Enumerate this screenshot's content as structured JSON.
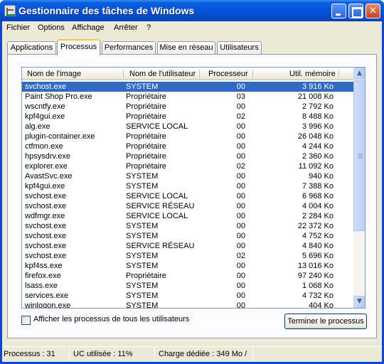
{
  "window": {
    "title": "Gestionnaire des tâches de Windows"
  },
  "menu": [
    "Fichier",
    "Options",
    "Affichage",
    "Arrêter",
    "?"
  ],
  "tabs": [
    "Applications",
    "Processus",
    "Performances",
    "Mise en réseau",
    "Utilisateurs"
  ],
  "active_tab": "Processus",
  "columns": [
    "Nom de l'image",
    "Nom de l'utilisateur",
    "Processeur",
    "Util. mémoire"
  ],
  "processes": [
    {
      "name": "svchost.exe",
      "user": "SYSTEM",
      "cpu": "00",
      "mem": "3 916 Ko",
      "selected": true
    },
    {
      "name": "Paint Shop Pro.exe",
      "user": "Propriétaire",
      "cpu": "03",
      "mem": "21 008 Ko"
    },
    {
      "name": "wscntfy.exe",
      "user": "Propriétaire",
      "cpu": "00",
      "mem": "2 792 Ko"
    },
    {
      "name": "kpf4gui.exe",
      "user": "Propriétaire",
      "cpu": "02",
      "mem": "8 488 Ko"
    },
    {
      "name": "alg.exe",
      "user": "SERVICE LOCAL",
      "cpu": "00",
      "mem": "3 996 Ko"
    },
    {
      "name": "plugin-container.exe",
      "user": "Propriétaire",
      "cpu": "00",
      "mem": "26 048 Ko"
    },
    {
      "name": "ctfmon.exe",
      "user": "Propriétaire",
      "cpu": "00",
      "mem": "4 244 Ko"
    },
    {
      "name": "hpsysdrv.exe",
      "user": "Propriétaire",
      "cpu": "00",
      "mem": "2 360 Ko"
    },
    {
      "name": "explorer.exe",
      "user": "Propriétaire",
      "cpu": "02",
      "mem": "11 092 Ko"
    },
    {
      "name": "AvastSvc.exe",
      "user": "SYSTEM",
      "cpu": "00",
      "mem": "940 Ko"
    },
    {
      "name": "kpf4gui.exe",
      "user": "SYSTEM",
      "cpu": "00",
      "mem": "7 388 Ko"
    },
    {
      "name": "svchost.exe",
      "user": "SERVICE LOCAL",
      "cpu": "00",
      "mem": "6 968 Ko"
    },
    {
      "name": "svchost.exe",
      "user": "SERVICE RÉSEAU",
      "cpu": "00",
      "mem": "4 004 Ko"
    },
    {
      "name": "wdfmgr.exe",
      "user": "SERVICE LOCAL",
      "cpu": "00",
      "mem": "2 284 Ko"
    },
    {
      "name": "svchost.exe",
      "user": "SYSTEM",
      "cpu": "00",
      "mem": "22 372 Ko"
    },
    {
      "name": "svchost.exe",
      "user": "SYSTEM",
      "cpu": "00",
      "mem": "4 752 Ko"
    },
    {
      "name": "svchost.exe",
      "user": "SERVICE RÉSEAU",
      "cpu": "00",
      "mem": "4 840 Ko"
    },
    {
      "name": "svchost.exe",
      "user": "SYSTEM",
      "cpu": "02",
      "mem": "5 696 Ko"
    },
    {
      "name": "kpf4ss.exe",
      "user": "SYSTEM",
      "cpu": "00",
      "mem": "13 016 Ko"
    },
    {
      "name": "firefox.exe",
      "user": "Propriétaire",
      "cpu": "00",
      "mem": "97 240 Ko"
    },
    {
      "name": "lsass.exe",
      "user": "SYSTEM",
      "cpu": "00",
      "mem": "1 068 Ko"
    },
    {
      "name": "services.exe",
      "user": "SYSTEM",
      "cpu": "00",
      "mem": "4 732 Ko"
    },
    {
      "name": "winlogon.exe",
      "user": "SYSTEM",
      "cpu": "00",
      "mem": "404 Ko"
    }
  ],
  "show_all_users": {
    "label": "Afficher les processus de tous les utilisateurs",
    "checked": false
  },
  "end_process_button": "Terminer le processus",
  "status": {
    "processes": "Processus : 31",
    "cpu": "UC utilisée : 11%",
    "commit": "Charge dédiée : 349 Mo /"
  },
  "colors": {
    "title_bar": "#0454d8",
    "selection": "#316ac5",
    "active_tab_accent": "#ffc83c",
    "close_button": "#c8421e"
  },
  "icons": [
    "taskmgr-icon",
    "minimize-icon",
    "maximize-icon",
    "close-icon",
    "scroll-up-icon",
    "scroll-down-icon"
  ]
}
